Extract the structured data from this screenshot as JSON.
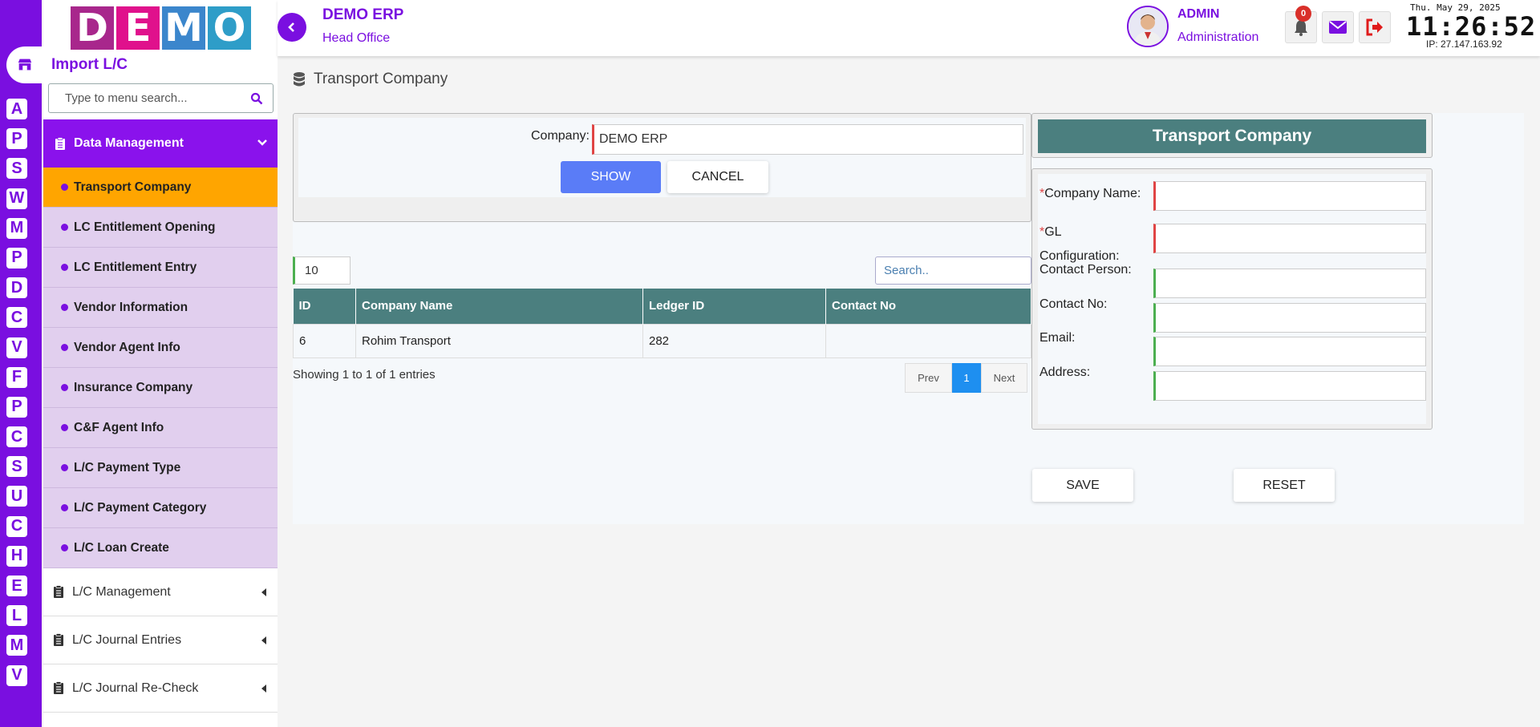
{
  "rail": {
    "letters": [
      "A",
      "P",
      "S",
      "W",
      "M",
      "P",
      "D",
      "C",
      "V",
      "F",
      "P",
      "C",
      "S",
      "U",
      "C",
      "H",
      "E",
      "L",
      "M",
      "V"
    ]
  },
  "logo": {
    "letters": [
      "D",
      "E",
      "M",
      "O"
    ],
    "colors": [
      "#a8278c",
      "#e0118c",
      "#3b86cc",
      "#2e9dc8"
    ]
  },
  "sidebar": {
    "module_title": "Import L/C",
    "search_placeholder": "Type to menu search...",
    "group": {
      "label": "Data Management"
    },
    "sub_items": [
      {
        "label": "Transport Company",
        "active": true
      },
      {
        "label": "LC Entitlement Opening"
      },
      {
        "label": "LC Entitlement Entry"
      },
      {
        "label": "Vendor Information"
      },
      {
        "label": "Vendor Agent Info"
      },
      {
        "label": "Insurance Company"
      },
      {
        "label": "C&F Agent Info"
      },
      {
        "label": "L/C Payment Type"
      },
      {
        "label": "L/C Payment Category"
      },
      {
        "label": "L/C Loan Create"
      }
    ],
    "collapsed_groups": [
      {
        "label": "L/C Management"
      },
      {
        "label": "L/C Journal Entries"
      },
      {
        "label": "L/C Journal Re-Check"
      }
    ]
  },
  "header": {
    "company_name": "DEMO ERP",
    "branch": "Head Office",
    "user_name": "ADMIN",
    "user_role": "Administration",
    "notification_count": "0",
    "date": "Thu. May 29, 2025",
    "time": "11:26:52",
    "ip": "IP: 27.147.163.92"
  },
  "page": {
    "title": "Transport Company"
  },
  "filter": {
    "company_label": "Company:",
    "company_value": "DEMO ERP",
    "show_label": "SHOW",
    "cancel_label": "CANCEL"
  },
  "table": {
    "page_size": "10",
    "search_placeholder": "Search..",
    "columns": [
      "ID",
      "Company Name",
      "Ledger ID",
      "Contact No"
    ],
    "rows": [
      [
        "6",
        "Rohim Transport",
        "282",
        ""
      ]
    ],
    "showing": "Showing 1 to 1 of 1 entries",
    "pager": {
      "prev": "Prev",
      "current": "1",
      "next": "Next"
    }
  },
  "form": {
    "title": "Transport Company",
    "fields": [
      {
        "label": "Company Name:",
        "required": true
      },
      {
        "label": "GL Configuration:",
        "required": true
      },
      {
        "label": "Contact Person:",
        "required": false
      },
      {
        "label": "Contact No:",
        "required": false
      },
      {
        "label": "Email:",
        "required": false
      },
      {
        "label": "Address:",
        "required": false
      }
    ],
    "save_label": "SAVE",
    "reset_label": "RESET"
  },
  "colors": {
    "brand_purple": "#7a0fe0",
    "active_orange": "#ffa500",
    "table_header": "#4b7f7f",
    "primary_button": "#5a7cf7"
  }
}
